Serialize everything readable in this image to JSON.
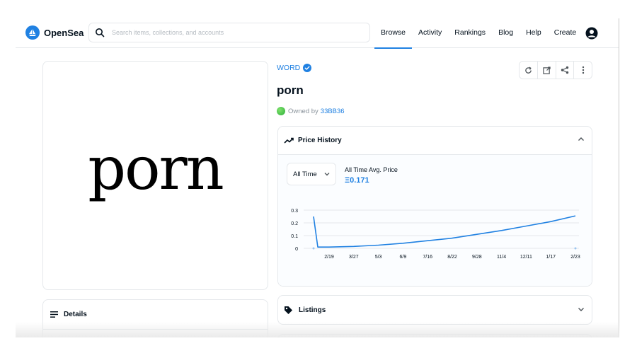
{
  "header": {
    "brand": "OpenSea",
    "search_placeholder": "Search items, collections, and accounts",
    "nav": [
      "Browse",
      "Activity",
      "Rankings",
      "Blog",
      "Help",
      "Create"
    ],
    "active_nav": "Browse"
  },
  "item": {
    "image_text": "porn",
    "collection": "WORD",
    "title": "porn",
    "owned_by_label": "Owned by",
    "owner": "33BB36"
  },
  "price_history": {
    "title": "Price History",
    "period": "All Time",
    "avg_label": "All Time Avg. Price",
    "avg_value": "Ξ0.171"
  },
  "sections": {
    "details": "Details",
    "listings": "Listings"
  },
  "colors": {
    "accent": "#2081e2",
    "border": "#e5e8eb",
    "text": "#04111d"
  },
  "icons": [
    "search-icon",
    "account-icon",
    "verified-icon",
    "refresh-icon",
    "external-link-icon",
    "share-icon",
    "more-icon",
    "price-history-icon",
    "chevron-up-icon",
    "chevron-down-icon",
    "tag-icon",
    "details-icon"
  ],
  "chart_data": {
    "type": "line",
    "x": [
      "2/19",
      "3/27",
      "5/3",
      "6/9",
      "7/16",
      "8/22",
      "9/28",
      "11/4",
      "12/11",
      "1/17",
      "2/23"
    ],
    "y_ticks": [
      0,
      0.1,
      0.2,
      0.3
    ],
    "ylim": [
      0,
      0.3
    ],
    "series": [
      {
        "values": [
          0.01,
          0.015,
          0.025,
          0.04,
          0.06,
          0.08,
          0.11,
          0.14,
          0.175,
          0.21,
          0.255
        ]
      }
    ],
    "start_spike": {
      "from": 0.25,
      "to": 0.01
    },
    "grid": true
  }
}
